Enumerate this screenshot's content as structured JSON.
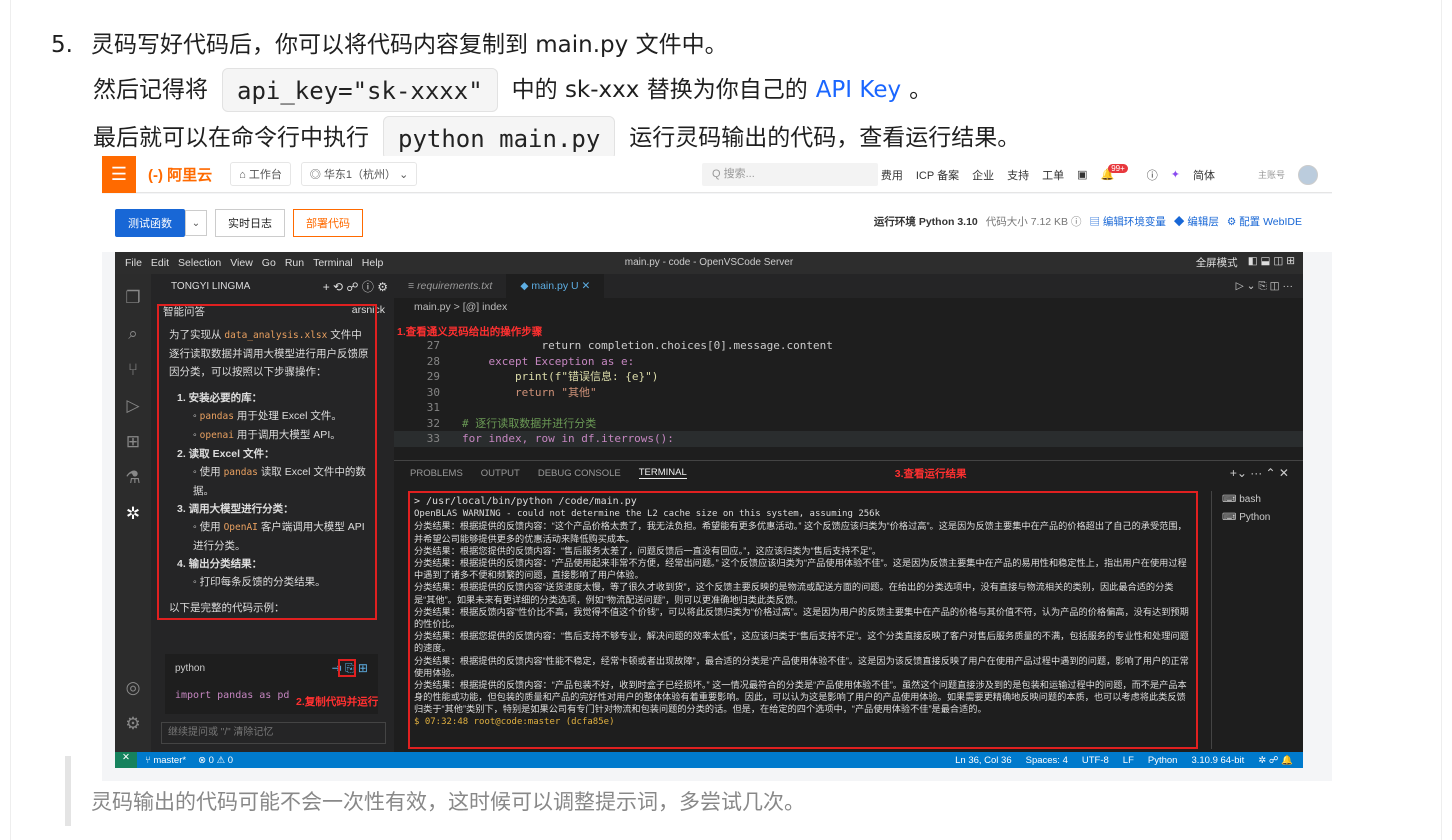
{
  "doc": {
    "step_num": "5.",
    "line1": "灵码写好代码后，你可以将代码内容复制到 main.py 文件中。",
    "line2_pre": "然后记得将",
    "line2_code": "api_key=\"sk-xxxx\"",
    "line2_mid": "中的 sk-xxx 替换为你自己的",
    "line2_link": "API Key",
    "line2_post": "。",
    "line3_pre": "最后就可以在命令行中执行",
    "line3_code": "python main.py",
    "line3_post": "运行灵码输出的代码，查看运行结果。",
    "quote": "灵码输出的代码可能不会一次性有效，这时候可以调整提示词，多尝试几次。"
  },
  "aliyun": {
    "logo": "(-) 阿里云",
    "workbench": "⌂ 工作台",
    "region": "◎ 华东1（杭州） ⌄",
    "search_placeholder": "Q 搜索...",
    "nav": [
      "费用",
      "ICP 备案",
      "企业",
      "支持",
      "工单"
    ],
    "badge": "99+",
    "lang": "简体",
    "account": "主账号",
    "btn_test": "测试函数",
    "btn_log": "实时日志",
    "btn_deploy": "部署代码",
    "runtime_label": "运行环境 Python 3.10",
    "code_size": "代码大小 7.12 KB ⓘ",
    "link_env": "编辑环境变量",
    "link_layer": "编辑层",
    "link_webide": "配置 WebIDE"
  },
  "vscode": {
    "menu": [
      "File",
      "Edit",
      "Selection",
      "View",
      "Go",
      "Run",
      "Terminal",
      "Help"
    ],
    "window_title": "main.py - code - OpenVSCode Server",
    "fullscreen": "全屏模式",
    "side_title": "TONGYI LINGMA",
    "chat_header": "智能问答",
    "chat_user": "arsnick",
    "chat_intro_pre": "为了实现从",
    "chat_intro_code": "data_analysis.xlsx",
    "chat_intro_post": "文件中逐行读取数据并调用大模型进行用户反馈原因分类，可以按照以下步骤操作：",
    "step1": "1. 安装必要的库：",
    "step1a_code": "pandas",
    "step1a": "用于处理 Excel 文件。",
    "step1b_code": "openai",
    "step1b": "用于调用大模型 API。",
    "step2": "2. 读取 Excel 文件：",
    "step2a_pre": "使用",
    "step2a_code": "pandas",
    "step2a": "读取 Excel 文件中的数据。",
    "step3": "3. 调用大模型进行分类：",
    "step3a_pre": "使用",
    "step3a_code": "OpenAI",
    "step3a": "客户端调用大模型 API 进行分类。",
    "step4": "4. 输出分类结果：",
    "step4a": "打印每条反馈的分类结果。",
    "chat_outro": "以下是完整的代码示例：",
    "code_lang": "python",
    "code_first": "import pandas as pd",
    "chat_input": "继续提问或 \"/\" 清除记忆",
    "tab1": "requirements.txt",
    "tab2": "main.py",
    "tab2_status": "U",
    "crumb": "main.py > [@] index",
    "lines": [
      {
        "n": "27",
        "t": "            return completion.choices[0].message.content"
      },
      {
        "n": "28",
        "t": "    except Exception as e:"
      },
      {
        "n": "29",
        "t": "        print(f\"错误信息: {e}\")"
      },
      {
        "n": "30",
        "t": "        return \"其他\""
      },
      {
        "n": "31",
        "t": ""
      },
      {
        "n": "32",
        "t": "# 逐行读取数据并进行分类"
      },
      {
        "n": "33",
        "t": "for index, row in df.iterrows():"
      }
    ],
    "panel_tabs": [
      "PROBLEMS",
      "OUTPUT",
      "DEBUG CONSOLE",
      "TERMINAL"
    ],
    "term_cmd": "> /usr/local/bin/python /code/main.py",
    "term_warn": "OpenBLAS WARNING - could not determine the L2 cache size on this system, assuming 256k",
    "term_lines": [
      "分类结果：根据提供的反馈内容：“这个产品价格太贵了，我无法负担。希望能有更多优惠活动。” 这个反馈应该归类为“价格过高”。这是因为反馈主要集中在产品的价格超出了自己的承受范围，并希望公司能够提供更多的优惠活动来降低购买成本。",
      "分类结果：根据您提供的反馈内容：“售后服务太差了，问题反馈后一直没有回应。”，这应该归类为“售后支持不足”。",
      "分类结果：根据提供的反馈内容：“产品使用起来非常不方便，经常出问题。” 这个反馈应该归类为“产品使用体验不佳”。这是因为反馈主要集中在产品的易用性和稳定性上，指出用户在使用过程中遇到了诸多不便和频繁的问题，直接影响了用户体验。",
      "分类结果：根据提供的反馈内容“送货速度太慢，等了很久才收到货”，这个反馈主要反映的是物流或配送方面的问题。在给出的分类选项中，没有直接与物流相关的类别，因此最合适的分类是“其他”。如果未来有更详细的分类选项，例如“物流配送问题”，则可以更准确地归类此类反馈。",
      "分类结果：根据反馈内容“性价比不高，我觉得不值这个价钱”，可以将此反馈归类为“价格过高”。这是因为用户的反馈主要集中在产品的价格与其价值不符，认为产品的价格偏高，没有达到预期的性价比。",
      "分类结果：根据您提供的反馈内容：“售后支持不够专业，解决问题的效率太低”，这应该归类于“售后支持不足”。这个分类直接反映了客户对售后服务质量的不满，包括服务的专业性和处理问题的速度。",
      "分类结果：根据提供的反馈内容“性能不稳定，经常卡顿或者出现故障”，最合适的分类是“产品使用体验不佳”。这是因为该反馈直接反映了用户在使用产品过程中遇到的问题，影响了用户的正常使用体验。",
      "分类结果：根据提供的反馈内容：“产品包装不好，收到时盒子已经损坏。” 这一情况最符合的分类是“产品使用体验不佳”。虽然这个问题直接涉及到的是包装和运输过程中的问题，而不是产品本身的性能或功能，但包装的质量和产品的完好性对用户的整体体验有着重要影响。因此，可以认为这是影响了用户的产品使用体验。如果需要更精确地反映问题的本质，也可以考虑将此类反馈归类于“其他”类别下，特别是如果公司有专门针对物流和包装问题的分类的话。但是，在给定的四个选项中，“产品使用体验不佳”是最合适的。"
    ],
    "term_prompt": "$ 07:32:48 root@code:master (dcfa85e)",
    "term_list": [
      "bash",
      "Python"
    ],
    "status_branch": "master*",
    "status_errors": "⊗ 0 ⚠ 0",
    "status_right": [
      "Ln 36, Col 36",
      "Spaces: 4",
      "UTF-8",
      "LF",
      "Python",
      "3.10.9 64-bit"
    ]
  },
  "annotations": {
    "a1": "1.查看通义灵码给出的操作步骤",
    "a2": "2.复制代码并运行",
    "a3": "3.查看运行结果"
  },
  "colors": {
    "accent": "#ff6a00",
    "annotation": "#e02020",
    "vscode_status": "#007acc",
    "link": "#1a66ff"
  }
}
